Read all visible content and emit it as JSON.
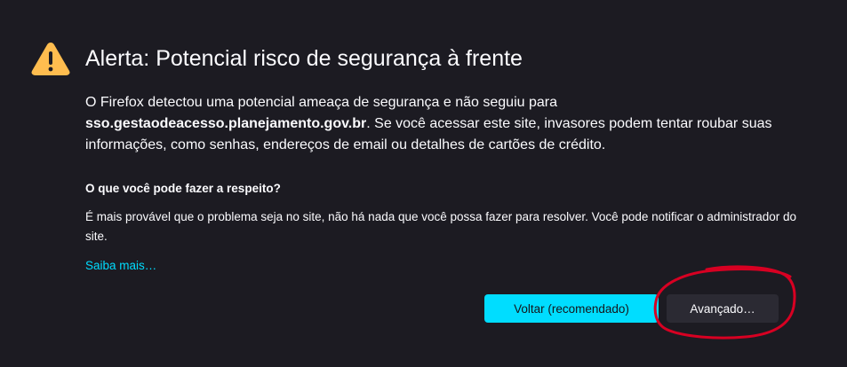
{
  "icon": {
    "name": "warning-icon",
    "color": "#ffbd4f"
  },
  "title": "Alerta: Potencial risco de segurança à frente",
  "description": {
    "line1": "O Firefox detectou uma potencial ameaça de segurança e não seguiu para",
    "host": "sso.gestaodeacesso.planejamento.gov.br",
    "line2": ". Se você acessar este site, invasores podem tentar roubar suas informações, como senhas, endereços de email ou detalhes de cartões de crédito."
  },
  "what_to_do": {
    "heading": "O que você pode fazer a respeito?",
    "text": "É mais provável que o problema seja no site, não há nada que você possa fazer para resolver. Você pode notificar o administrador do site."
  },
  "learn_more": "Saiba mais…",
  "buttons": {
    "back": "Voltar (recomendado)",
    "advanced": "Avançado…"
  },
  "colors": {
    "background": "#1c1b22",
    "accent": "#00ddff",
    "annotation": "#d70022"
  }
}
